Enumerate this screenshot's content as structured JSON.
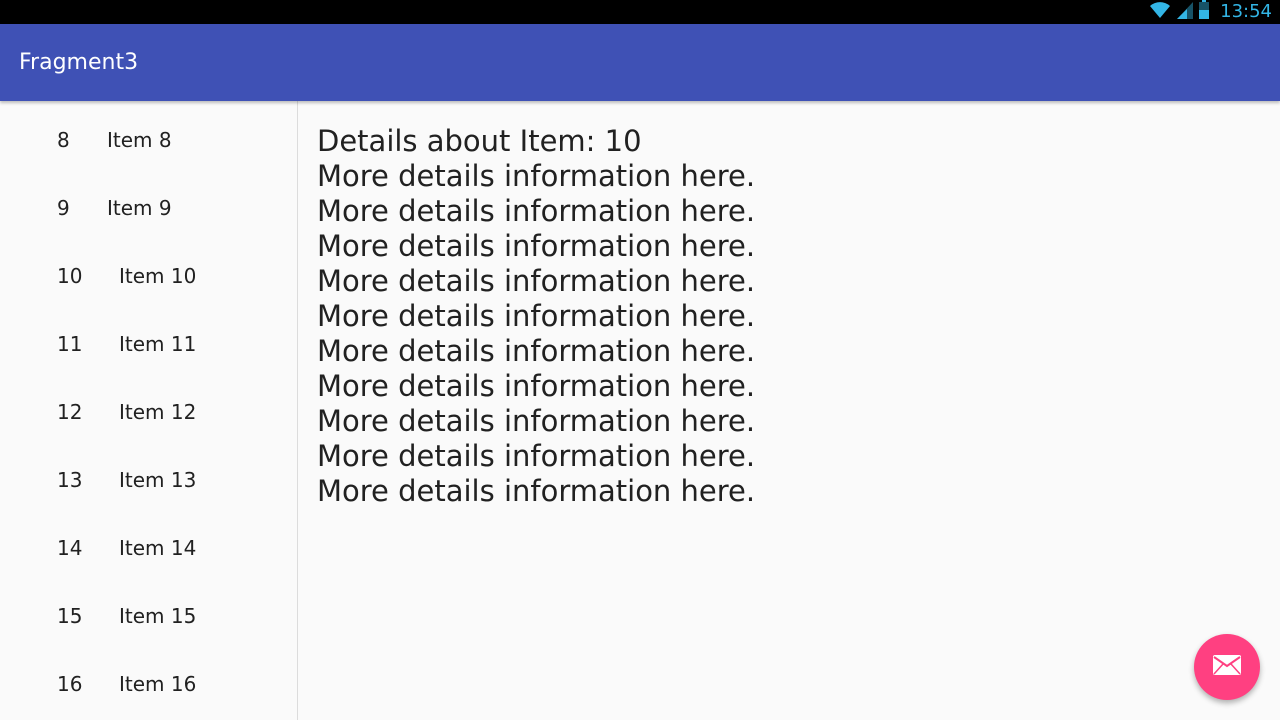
{
  "status_bar": {
    "time": "13:54",
    "icons": [
      "wifi-icon",
      "cell-signal-icon",
      "battery-icon"
    ],
    "icon_color": "#33b5e5"
  },
  "app_bar": {
    "title": "Fragment3",
    "color": "#3f51b5"
  },
  "item_list": [
    {
      "id": "8",
      "content": "Item 8"
    },
    {
      "id": "9",
      "content": "Item 9"
    },
    {
      "id": "10",
      "content": "Item 10"
    },
    {
      "id": "11",
      "content": "Item 11"
    },
    {
      "id": "12",
      "content": "Item 12"
    },
    {
      "id": "13",
      "content": "Item 13"
    },
    {
      "id": "14",
      "content": "Item 14"
    },
    {
      "id": "15",
      "content": "Item 15"
    },
    {
      "id": "16",
      "content": "Item 16"
    }
  ],
  "detail": {
    "title": "Details about Item: 10",
    "lines": [
      "More details information here.",
      "More details information here.",
      "More details information here.",
      "More details information here.",
      "More details information here.",
      "More details information here.",
      "More details information here.",
      "More details information here.",
      "More details information here.",
      "More details information here."
    ]
  },
  "fab": {
    "icon": "email-icon",
    "color": "#ff4081"
  }
}
